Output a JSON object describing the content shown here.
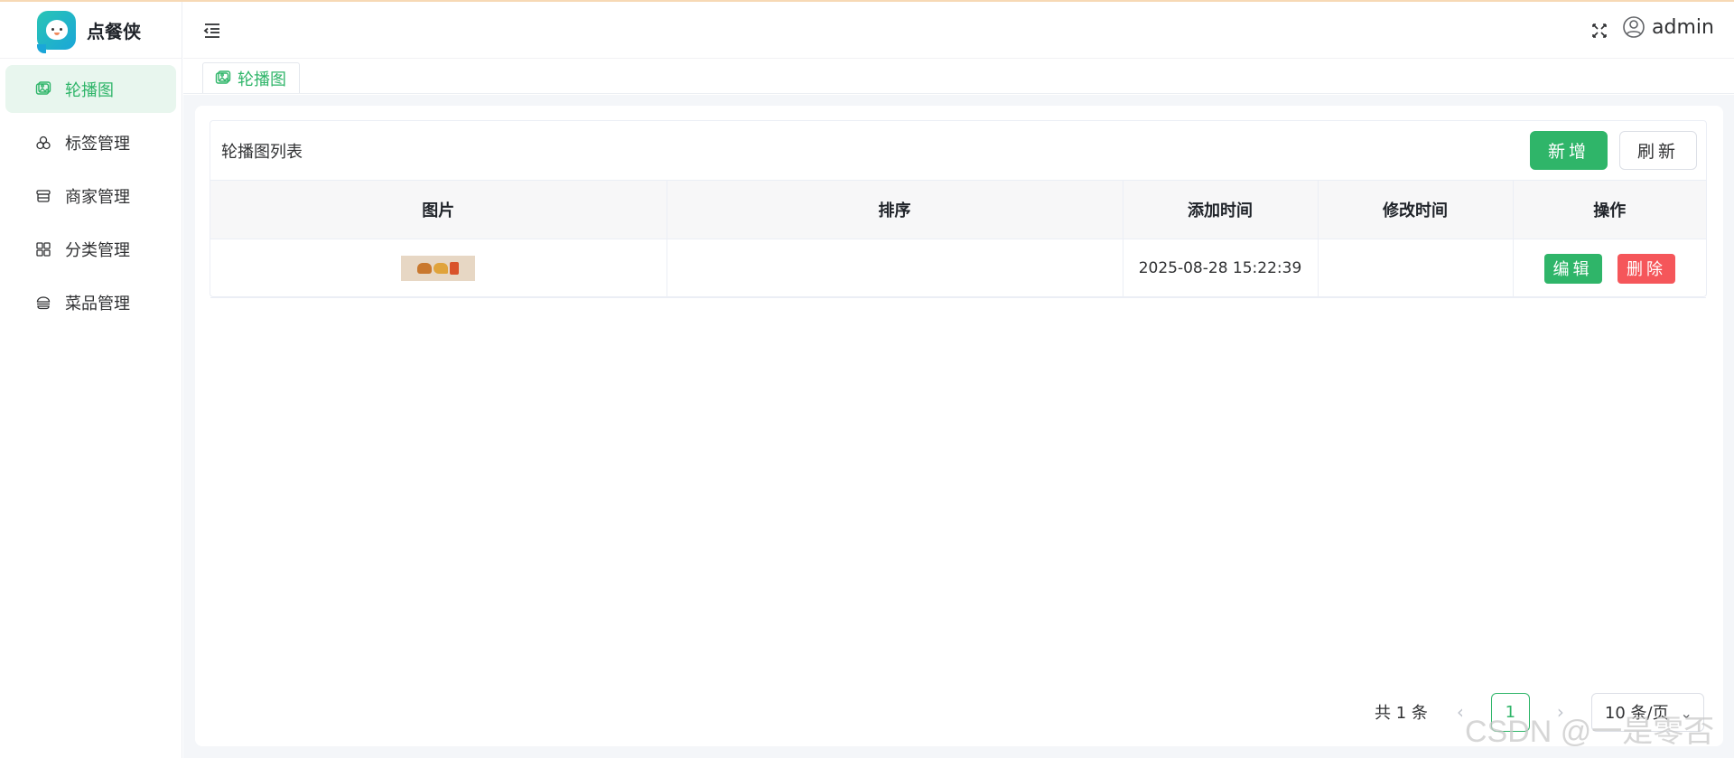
{
  "app": {
    "name": "点餐侠"
  },
  "sidebar": {
    "items": [
      {
        "label": "轮播图",
        "icon": "image-icon",
        "active": true
      },
      {
        "label": "标签管理",
        "icon": "tags-icon",
        "active": false
      },
      {
        "label": "商家管理",
        "icon": "store-icon",
        "active": false
      },
      {
        "label": "分类管理",
        "icon": "grid-icon",
        "active": false
      },
      {
        "label": "菜品管理",
        "icon": "burger-icon",
        "active": false
      }
    ]
  },
  "header": {
    "user": "admin"
  },
  "tabs": [
    {
      "label": "轮播图",
      "icon": "image-icon"
    }
  ],
  "panel": {
    "title": "轮播图列表",
    "add_label": "新增",
    "refresh_label": "刷新"
  },
  "table": {
    "columns": [
      "图片",
      "排序",
      "添加时间",
      "修改时间",
      "操作"
    ],
    "rows": [
      {
        "image": "carousel-thumbnail",
        "sort": "",
        "created": "2025-08-28 15:22:39",
        "updated": ""
      }
    ],
    "edit_label": "编辑",
    "delete_label": "删除"
  },
  "pagination": {
    "total_text": "共 1 条",
    "current": "1",
    "page_size": "10 条/页"
  },
  "watermark": "CSDN @一是零否",
  "colors": {
    "primary": "#2fb569",
    "danger": "#f5565a",
    "active_bg": "#e8f6ee"
  }
}
